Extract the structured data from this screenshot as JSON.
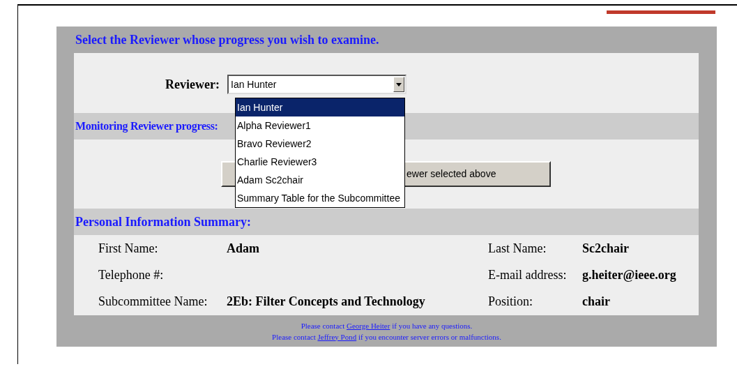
{
  "heading": "Select the Reviewer whose progress you wish to examine.",
  "reviewer": {
    "label": "Reviewer:",
    "value": "Ian Hunter",
    "expanded": true,
    "options": [
      {
        "label": "Ian Hunter",
        "selected": true
      },
      {
        "label": "Alpha Reviewer1",
        "selected": false
      },
      {
        "label": "Bravo Reviewer2",
        "selected": false
      },
      {
        "label": "Charlie Reviewer3",
        "selected": false
      },
      {
        "label": "Adam Sc2chair",
        "selected": false
      },
      {
        "label": "Summary Table for the Subcommittee",
        "selected": false
      }
    ]
  },
  "monitoring": {
    "heading": "Monitoring Reviewer progress:",
    "button": "ewer selected above"
  },
  "personal": {
    "heading": "Personal Information Summary:",
    "rows": [
      {
        "left": {
          "label": "First Name:",
          "value": "Adam"
        },
        "right": {
          "label": "Last Name:",
          "value": "Sc2chair"
        }
      },
      {
        "left": {
          "label": "Telephone #:"
        },
        "right": {
          "label": "E-mail address:",
          "value": "g.heiter@ieee.org"
        }
      },
      {
        "left": {
          "label": "Subcommittee Name:",
          "value": "2Eb: Filter Concepts and Technology"
        },
        "right": {
          "label": "Position:",
          "value": "chair"
        }
      }
    ]
  },
  "footer": [
    {
      "before": "Please contact",
      "link": "George Heiter",
      "after": "if you have any questions."
    },
    {
      "before": "Please contact",
      "link": "Jeffrey Pond",
      "after": "if you encounter server errors or malfunctions."
    }
  ]
}
